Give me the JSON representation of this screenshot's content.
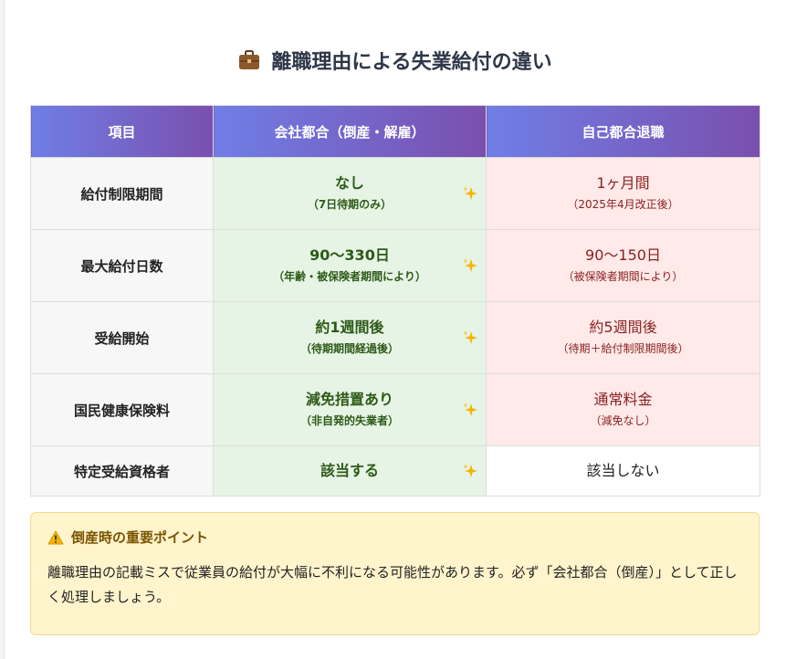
{
  "title": "離職理由による失業給付の違い",
  "icons": {
    "title": "briefcase-icon",
    "company": "sparkles-icon",
    "callout": "warning-icon"
  },
  "colors": {
    "header_start": "#6f7ee6",
    "header_end": "#7a4fae",
    "company_bg": "#e6f4e6",
    "self_bg": "#ffe9e9",
    "callout_bg": "#fff4cc"
  },
  "table": {
    "headers": [
      "項目",
      "会社都合（倒産・解雇）",
      "自己都合退職"
    ],
    "rows": [
      {
        "item": "給付制限期間",
        "company_main": "なし",
        "company_sub": "（7日待期のみ）",
        "self_main": "1ヶ月間",
        "self_sub": "（2025年4月改正後）"
      },
      {
        "item": "最大給付日数",
        "company_main": "90～330日",
        "company_sub": "（年齢・被保険者期間により）",
        "self_main": "90～150日",
        "self_sub": "（被保険者期間により）"
      },
      {
        "item": "受給開始",
        "company_main": "約1週間後",
        "company_sub": "（待期期間経過後）",
        "self_main": "約5週間後",
        "self_sub": "（待期＋給付制限期間後）"
      },
      {
        "item": "国民健康保険料",
        "company_main": "減免措置あり",
        "company_sub": "（非自発的失業者）",
        "self_main": "通常料金",
        "self_sub": "（減免なし）"
      },
      {
        "item": "特定受給資格者",
        "company_main": "該当する",
        "self_main": "該当しない"
      }
    ]
  },
  "callout": {
    "title": "倒産時の重要ポイント",
    "body": "離職理由の記載ミスで従業員の給付が大幅に不利になる可能性があります。必ず「会社都合（倒産）」として正しく処理しましょう。"
  }
}
